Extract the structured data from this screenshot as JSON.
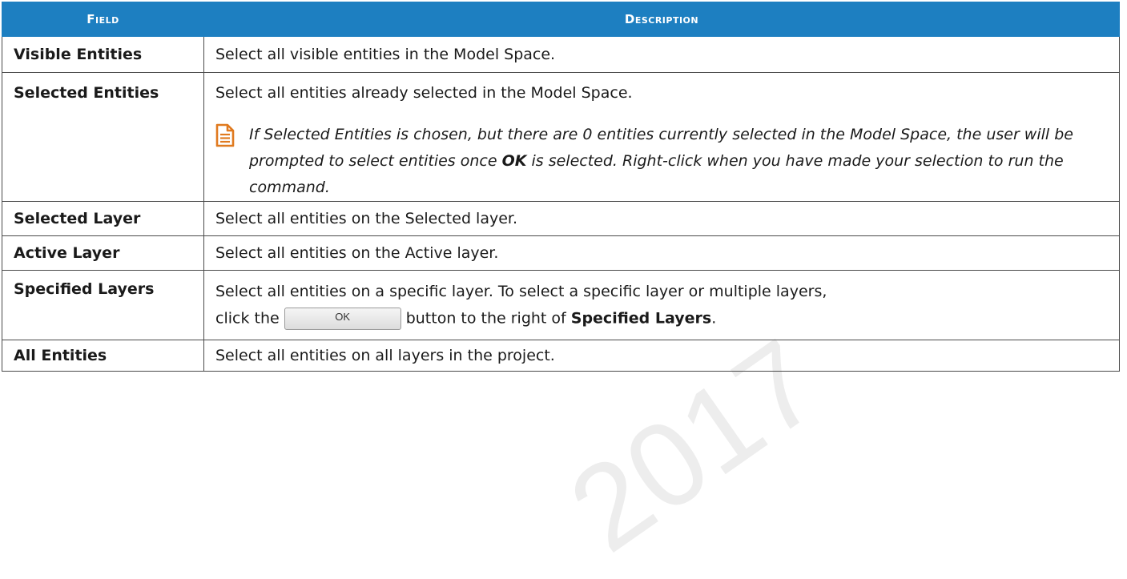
{
  "header": {
    "field": "Field",
    "description": "Description"
  },
  "rows": [
    {
      "field": "Visible Entities",
      "description": "Select all visible entities in the Model Space."
    },
    {
      "field": "Selected Entities",
      "description": "Select all entities already selected in the Model Space.",
      "note": {
        "icon": "document-note-icon",
        "text_before": "If Selected Entities is chosen, but there are 0 entities currently selected in the Model Space, the user will be prompted to select entities once ",
        "text_bold": "OK",
        "text_after": " is selected. Right-click when you have made your selection to run the command."
      }
    },
    {
      "field": "Selected Layer",
      "description": "Select all entities on the Selected layer."
    },
    {
      "field": "Active Layer",
      "description": "Select all entities on the Active layer."
    },
    {
      "field": "Specified Layers",
      "description_line1": "Select all entities on a specific layer.  To select a specific layer or multiple layers,",
      "line2_before": "click the",
      "button_label": "OK",
      "line2_after": "button to the right of ",
      "line2_bold": "Specified Layers",
      "line2_end": "."
    },
    {
      "field": "All Entities",
      "description": "Select all entities on all layers in the project."
    }
  ],
  "colors": {
    "header_bg": "#1d7fc1",
    "note_icon": "#e07a1f"
  }
}
